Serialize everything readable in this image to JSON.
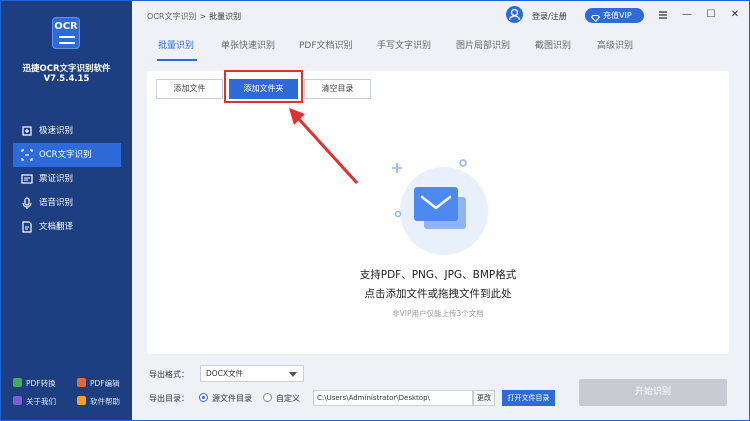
{
  "app": {
    "logo_text": "OCR",
    "name": "迅捷OCR文字识别软件",
    "version": "V7.5.4.15"
  },
  "sidebar": {
    "items": [
      {
        "label": "极速识别",
        "icon": "lightning-icon",
        "active": false
      },
      {
        "label": "OCR文字识别",
        "icon": "ocr-icon",
        "active": true
      },
      {
        "label": "票证识别",
        "icon": "ticket-icon",
        "active": false
      },
      {
        "label": "语音识别",
        "icon": "microphone-icon",
        "active": false
      },
      {
        "label": "文档翻译",
        "icon": "translate-icon",
        "active": false
      }
    ],
    "tools": [
      {
        "label": "PDF转换",
        "color": "#3fae5a"
      },
      {
        "label": "PDF编辑",
        "color": "#e0683a"
      },
      {
        "label": "关于我们",
        "color": "#7b5fd6"
      },
      {
        "label": "软件帮助",
        "color": "#f0a030"
      }
    ]
  },
  "header": {
    "breadcrumb_root": "OCR文字识别",
    "breadcrumb_sep": ">",
    "breadcrumb_current": "批量识别",
    "login_label": "登录/注册",
    "vip_label": "充值VIP",
    "minimize": "—",
    "maximize": "☐",
    "close": "✕"
  },
  "tabs": [
    {
      "label": "批量识别",
      "active": true
    },
    {
      "label": "单张快速识别",
      "active": false
    },
    {
      "label": "PDF文档识别",
      "active": false
    },
    {
      "label": "手写文字识别",
      "active": false
    },
    {
      "label": "图片局部识别",
      "active": false
    },
    {
      "label": "截图识别",
      "active": false
    },
    {
      "label": "高级识别",
      "active": false
    }
  ],
  "actions": {
    "add_file": "添加文件",
    "add_folder": "添加文件夹",
    "clear_list": "清空目录"
  },
  "drop_zone": {
    "line1": "支持PDF、PNG、JPG、BMP格式",
    "line2": "点击添加文件或拖拽文件到此处",
    "note": "非VIP用户仅能上传3个文档"
  },
  "options": {
    "format_label": "导出格式：",
    "format_value": "DOCX文件",
    "dir_label": "导出目录：",
    "radio_source": "源文件目录",
    "radio_custom": "自定义",
    "path_value": "C:\\Users\\Administrator\\Desktop\\",
    "change_button": "更改",
    "open_folder_button": "打开文件目录",
    "start_button": "开始识别"
  },
  "colors": {
    "sidebar_bg": "#1d3e80",
    "accent": "#2f6bd8",
    "highlight_red": "#e03030"
  }
}
